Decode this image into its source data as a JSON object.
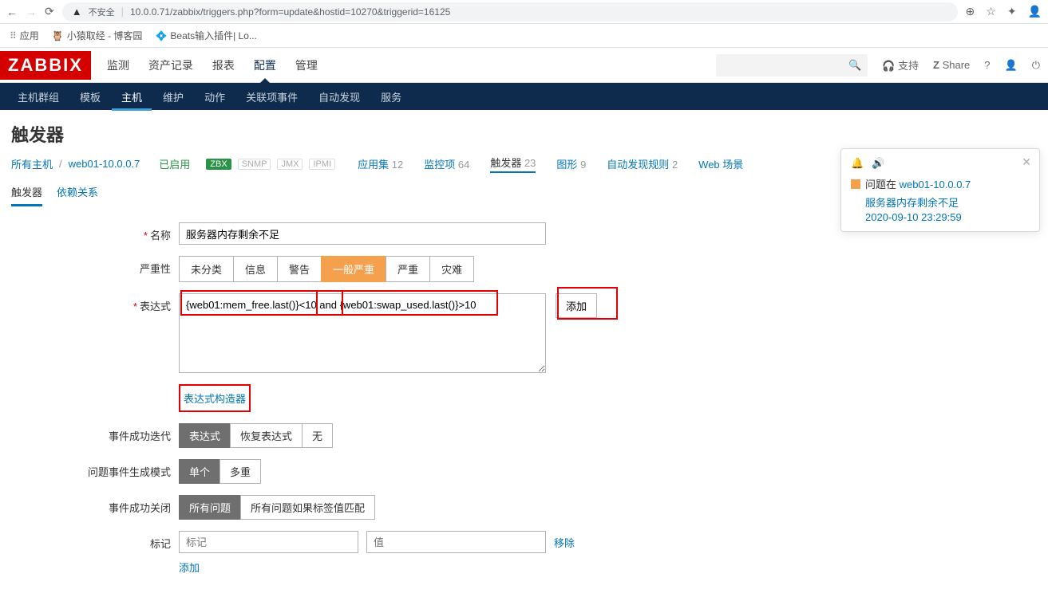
{
  "browser": {
    "warn_text": "不安全",
    "url": "10.0.0.71/zabbix/triggers.php?form=update&hostid=10270&triggerid=16125"
  },
  "bookmarks": {
    "apps": "应用",
    "b1": "小猿取经 - 博客园",
    "b2": "Beats输入插件| Lo..."
  },
  "logo": "ZABBIX",
  "nav": {
    "monitoring": "监测",
    "inventory": "资产记录",
    "reports": "报表",
    "config": "配置",
    "admin": "管理"
  },
  "header_right": {
    "support": "支持",
    "share": "Share"
  },
  "subnav": {
    "hostgroups": "主机群组",
    "templates": "模板",
    "hosts": "主机",
    "maintenance": "维护",
    "actions": "动作",
    "correlation": "关联项事件",
    "discovery": "自动发现",
    "services": "服务"
  },
  "page_title": "触发器",
  "breadcrumb": {
    "all_hosts": "所有主机",
    "host": "web01-10.0.0.7",
    "enabled": "已启用",
    "zbx": "ZBX",
    "snmp": "SNMP",
    "jmx": "JMX",
    "ipmi": "IPMI",
    "apps": "应用集",
    "apps_n": "12",
    "items": "监控项",
    "items_n": "64",
    "triggers": "触发器",
    "triggers_n": "23",
    "graphs": "图形",
    "graphs_n": "9",
    "disc": "自动发现规则",
    "disc_n": "2",
    "web": "Web 场景"
  },
  "tabs": {
    "trigger": "触发器",
    "deps": "依赖关系"
  },
  "form": {
    "name_label": "名称",
    "name_value": "服务器内存剩余不足",
    "severity_label": "严重性",
    "sev": {
      "s0": "未分类",
      "s1": "信息",
      "s2": "警告",
      "s3": "一般严重",
      "s4": "严重",
      "s5": "灾难"
    },
    "expr_label": "表达式",
    "expr_value": "{web01:mem_free.last()}<10 and {web01:swap_used.last()}>10",
    "add_btn": "添加",
    "constructor": "表达式构造器",
    "ok_iter_label": "事件成功迭代",
    "ok_iter": {
      "a": "表达式",
      "b": "恢复表达式",
      "c": "无"
    },
    "gen_mode_label": "问题事件生成模式",
    "gen_mode": {
      "a": "单个",
      "b": "多重"
    },
    "ok_close_label": "事件成功关闭",
    "ok_close": {
      "a": "所有问题",
      "b": "所有问题如果标签值匹配"
    },
    "tags_label": "标记",
    "tag_placeholder": "标记",
    "val_placeholder": "值",
    "remove": "移除",
    "add_link": "添加"
  },
  "notif": {
    "title_prefix": "问题在",
    "host": "web01-10.0.0.7",
    "sub": "服务器内存剩余不足",
    "date": "2020-09-10 23:29:59"
  }
}
